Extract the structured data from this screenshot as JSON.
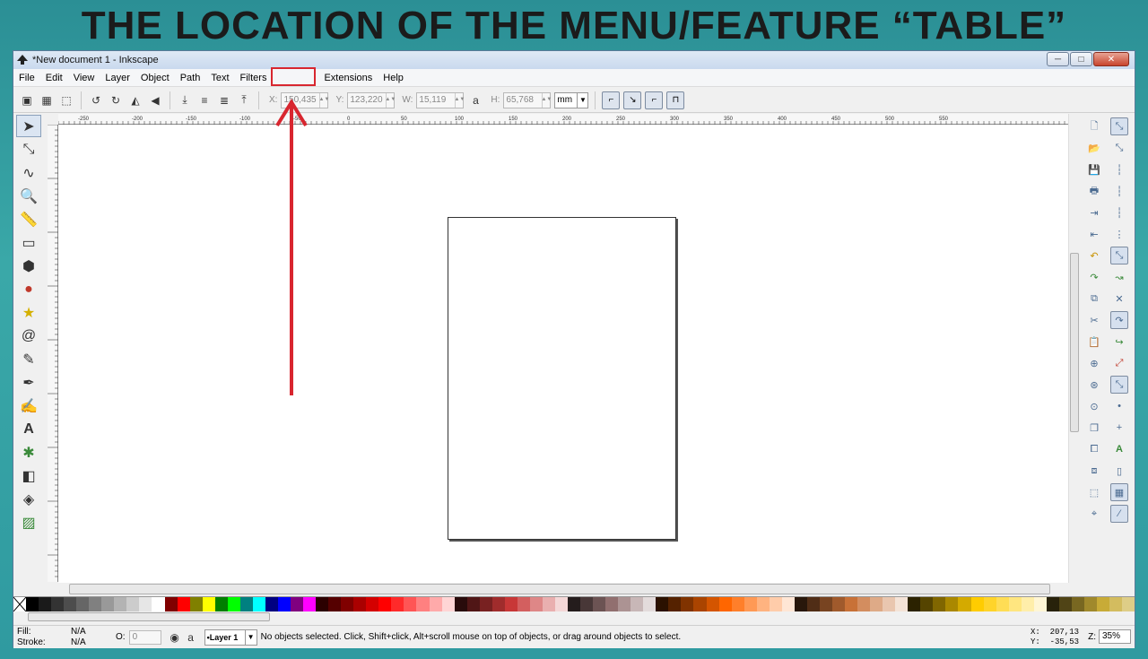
{
  "banner": {
    "text": "THE LOCATION OF THE MENU/FEATURE “TABLE”"
  },
  "window": {
    "title": "*New document 1 - Inkscape",
    "controls": {
      "minimize": "─",
      "maximize": "□",
      "close": "✕"
    }
  },
  "menu": {
    "items": [
      "File",
      "Edit",
      "View",
      "Layer",
      "Object",
      "Path",
      "Text",
      "Filters",
      "",
      "Extensions",
      "Help"
    ]
  },
  "toolbar": {
    "x_label": "X:",
    "x_value": "150,435",
    "y_label": "Y:",
    "y_value": "123,220",
    "w_label": "W:",
    "w_value": "15,119",
    "h_label": "H:",
    "h_value": "65,768",
    "unit": "mm"
  },
  "ruler": {
    "labels": [
      "-250",
      "-200",
      "-150",
      "-100",
      "-50",
      "0",
      "50",
      "100",
      "150",
      "200",
      "250",
      "300",
      "350",
      "400",
      "450",
      "500",
      "550"
    ]
  },
  "palette": {
    "colors": [
      "#000000",
      "#1a1a1a",
      "#333333",
      "#4d4d4d",
      "#666666",
      "#808080",
      "#999999",
      "#b3b3b3",
      "#cccccc",
      "#e6e6e6",
      "#ffffff",
      "#800000",
      "#ff0000",
      "#808000",
      "#ffff00",
      "#008000",
      "#00ff00",
      "#008080",
      "#00ffff",
      "#000080",
      "#0000ff",
      "#800080",
      "#ff00ff",
      "#2b0000",
      "#550000",
      "#800000",
      "#aa0000",
      "#d40000",
      "#ff0000",
      "#ff2a2a",
      "#ff5555",
      "#ff8080",
      "#ffaaaa",
      "#ffd5d5",
      "#280b0b",
      "#501616",
      "#782121",
      "#a02c2c",
      "#c83737",
      "#d35f5f",
      "#de8787",
      "#e9afaf",
      "#f4d7d7",
      "#241c1c",
      "#483737",
      "#6c5353",
      "#916f6f",
      "#ac9393",
      "#c8b7b7",
      "#e3dbdb",
      "#2b1100",
      "#552200",
      "#803300",
      "#aa4400",
      "#d45500",
      "#ff6600",
      "#ff7f2a",
      "#ff9955",
      "#ffb380",
      "#ffccaa",
      "#ffe6d5",
      "#28170b",
      "#502d16",
      "#784421",
      "#a05a2c",
      "#c87137",
      "#d38d5f",
      "#deaa87",
      "#e9c6af",
      "#f4e3d7",
      "#2b2200",
      "#554400",
      "#806600",
      "#aa8800",
      "#d4aa00",
      "#ffcc00",
      "#ffd42a",
      "#ffdd55",
      "#ffe680",
      "#ffeeaa",
      "#fff6d5",
      "#28220b",
      "#504416",
      "#786721",
      "#a0892c",
      "#c8ab37",
      "#d3bc5f",
      "#decd87"
    ]
  },
  "status": {
    "fill_label": "Fill:",
    "fill_value": "N/A",
    "stroke_label": "Stroke:",
    "stroke_value": "N/A",
    "opacity_label": "O:",
    "opacity_value": "0",
    "layer": "•Layer 1",
    "message": "No objects selected. Click, Shift+click, Alt+scroll mouse on top of objects, or drag around objects to select.",
    "x_label": "X:",
    "x_value": "207,13",
    "y_label": "Y:",
    "y_value": "-35,53",
    "zoom_label": "Z:",
    "zoom_value": "35%"
  },
  "annotation": {
    "color": "#d8262f"
  }
}
